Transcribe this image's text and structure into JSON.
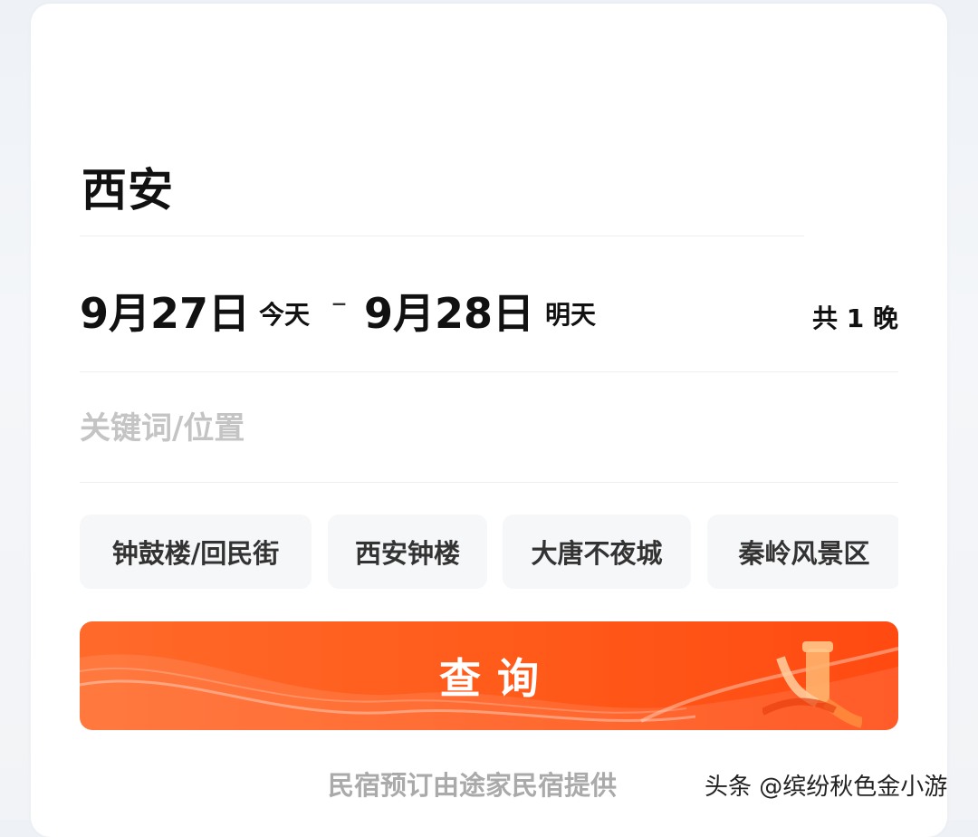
{
  "destination": {
    "city": "西安"
  },
  "dates": {
    "checkin_date": "9月27日",
    "checkin_day": "今天",
    "separator": "–",
    "checkout_date": "9月28日",
    "checkout_day": "明天",
    "nights": "共 1 晚"
  },
  "search": {
    "placeholder": "关键词/位置",
    "value": ""
  },
  "hot_tags": [
    {
      "label": "钟鼓楼/回民街"
    },
    {
      "label": "西安钟楼"
    },
    {
      "label": "大唐不夜城"
    },
    {
      "label": "秦岭风景区"
    }
  ],
  "search_button": {
    "label": "查询"
  },
  "footer": {
    "provider_note": "民宿预订由途家民宿提供"
  },
  "watermark": {
    "text": "头条 @缤纷秋色金小游"
  },
  "colors": {
    "accent": "#ff5a1a",
    "text_primary": "#111111",
    "placeholder": "#c4c4c4",
    "tag_bg": "#f6f7f9"
  }
}
